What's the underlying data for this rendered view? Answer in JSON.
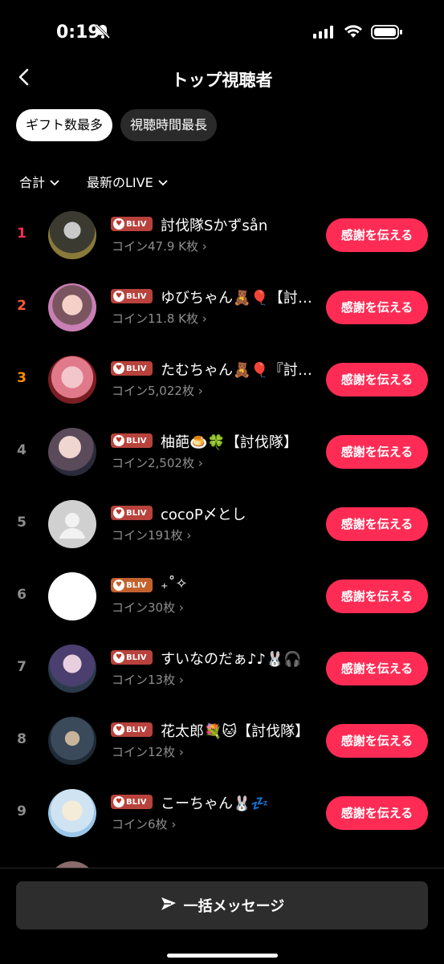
{
  "status_bar": {
    "time": "0:19"
  },
  "header": {
    "title": "トップ視聴者"
  },
  "tabs": [
    {
      "label": "ギフト数最多",
      "active": true
    },
    {
      "label": "視聴時間最長",
      "active": false
    }
  ],
  "filters": [
    {
      "label": "合計"
    },
    {
      "label": "最新のLIVE"
    }
  ],
  "badge_text": "BLIV",
  "thank_label": "感謝を伝える",
  "rows": [
    {
      "rank": "1",
      "name": "討伐隊Sかずsån",
      "coins": "コイン47.9 K枚",
      "rank_color": "#fe2c55"
    },
    {
      "rank": "2",
      "name": "ゆびちゃん🧸🎈【討伐隊】",
      "coins": "コイン11.8 K枚",
      "rank_color": "#fe5a36"
    },
    {
      "rank": "3",
      "name": "たむちゃん🧸🎈『討伐隊』",
      "coins": "コイン5,022枚",
      "rank_color": "#ff8a00"
    },
    {
      "rank": "4",
      "name": "柚葩🍮🍀【討伐隊】",
      "coins": "コイン2,502枚",
      "rank_color": "#8e8e8e"
    },
    {
      "rank": "5",
      "name": "cocoP〆とし",
      "coins": "コイン191枚",
      "rank_color": "#8e8e8e"
    },
    {
      "rank": "6",
      "name": "₊˚✧",
      "coins": "コイン30枚",
      "rank_color": "#8e8e8e"
    },
    {
      "rank": "7",
      "name": "すいなのだぁ♪♪🐰🎧",
      "coins": "コイン13枚",
      "rank_color": "#8e8e8e"
    },
    {
      "rank": "8",
      "name": "花太郎💐🐱【討伐隊】",
      "coins": "コイン12枚",
      "rank_color": "#8e8e8e"
    },
    {
      "rank": "9",
      "name": "こーちゃん🐰💤",
      "coins": "コイン6枚",
      "rank_color": "#8e8e8e"
    }
  ],
  "bottom": {
    "bulk_message_label": "一括メッセージ"
  }
}
